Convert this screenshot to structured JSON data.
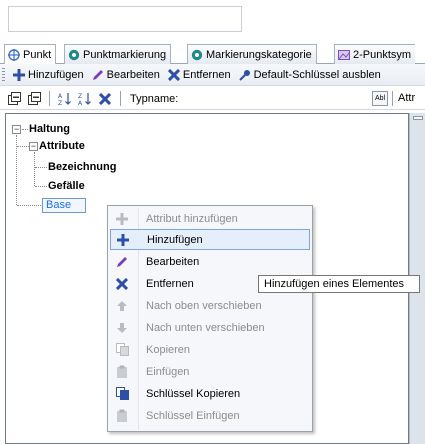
{
  "tabs": [
    {
      "label": "Punkt",
      "icon": "target-point-icon",
      "color": "#3b6fc8"
    },
    {
      "label": "Punktmarkierung",
      "icon": "gear-marker-icon",
      "color": "#1f8a8a"
    },
    {
      "label": "Markierungskategorie",
      "icon": "gear-marker-icon",
      "color": "#1f8a8a"
    },
    {
      "label": "2-Punktsym",
      "icon": "picture-icon",
      "color": "#7a4fb5"
    }
  ],
  "toolbar": {
    "add_label": "Hinzufügen",
    "edit_label": "Bearbeiten",
    "remove_label": "Entfernen",
    "default_key_label": "Default-Schlüssel ausblen"
  },
  "toolbar2": {
    "typename_label": "Typname:",
    "abl_label": "Abl",
    "attr_label": "Attr"
  },
  "tree": {
    "root": "Haltung",
    "attributes": "Attribute",
    "child1": "Bezeichnung",
    "child2": "Gefälle",
    "base": "Base"
  },
  "context_menu": {
    "items": [
      {
        "label": "Attribut hinzufügen",
        "icon": "plus-icon",
        "enabled": false
      },
      {
        "label": "Hinzufügen",
        "icon": "plus-icon",
        "enabled": true,
        "highlighted": true
      },
      {
        "label": "Bearbeiten",
        "icon": "pencil-icon",
        "enabled": true
      },
      {
        "label": "Entfernen",
        "icon": "x-icon",
        "enabled": true
      },
      {
        "label": "Nach oben verschieben",
        "icon": "arrow-up-icon",
        "enabled": false
      },
      {
        "label": "Nach unten verschieben",
        "icon": "arrow-down-icon",
        "enabled": false
      },
      {
        "label": "Kopieren",
        "icon": "copy-icon",
        "enabled": false
      },
      {
        "label": "Einfügen",
        "icon": "paste-icon",
        "enabled": false
      },
      {
        "label": "Schlüssel Kopieren",
        "icon": "copy-icon",
        "enabled": true
      },
      {
        "label": "Schlüssel Einfügen",
        "icon": "paste-icon",
        "enabled": false
      }
    ]
  },
  "tooltip": {
    "text": "Hinzufügen eines Elementes"
  },
  "colors": {
    "accent_blue": "#3b6fc8",
    "add_green": "#3c8f3c",
    "edit_purple": "#7a3fb5",
    "remove_blue": "#2e4fa8",
    "selection_text": "#1a6ee6"
  }
}
